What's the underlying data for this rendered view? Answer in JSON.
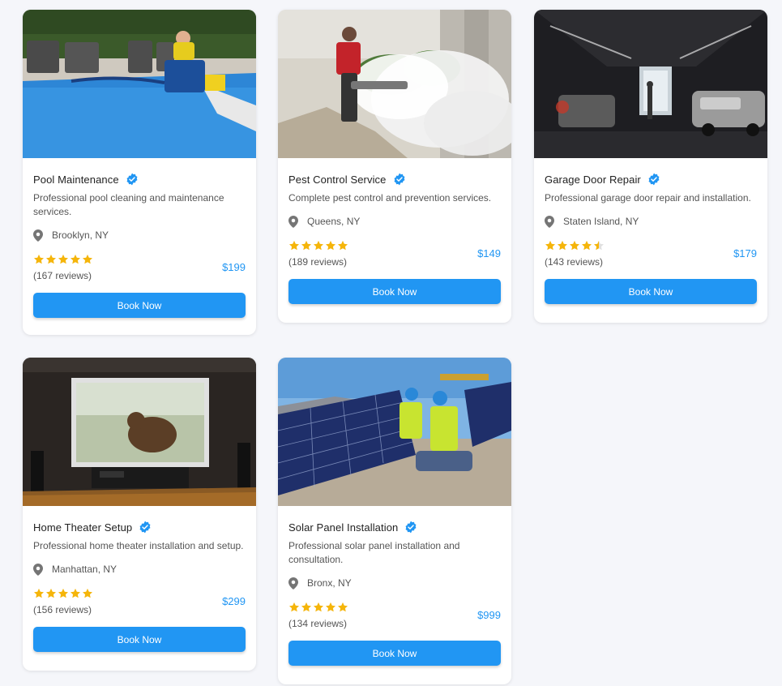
{
  "colors": {
    "accent": "#2196f3",
    "star": "#f5b50a",
    "verified": "#2196f3",
    "background": "#f5f6fa"
  },
  "icons": {
    "verified": "verified-badge-icon",
    "location": "map-pin-icon",
    "star": "star-icon"
  },
  "button_label": "Book Now",
  "services": [
    {
      "title": "Pool Maintenance",
      "description": "Professional pool cleaning and maintenance services.",
      "location": "Brooklyn, NY",
      "rating": 5,
      "reviews": "(167 reviews)",
      "price": "$199",
      "image": "pool-cleaning-photo"
    },
    {
      "title": "Pest Control Service",
      "description": "Complete pest control and prevention services.",
      "location": "Queens, NY",
      "rating": 5,
      "reviews": "(189 reviews)",
      "price": "$149",
      "image": "pest-fogging-photo"
    },
    {
      "title": "Garage Door Repair",
      "description": "Professional garage door repair and installation.",
      "location": "Staten Island, NY",
      "rating": 4.5,
      "reviews": "(143 reviews)",
      "price": "$179",
      "image": "garage-workshop-photo"
    },
    {
      "title": "Home Theater Setup",
      "description": "Professional home theater installation and setup.",
      "location": "Manhattan, NY",
      "rating": 5,
      "reviews": "(156 reviews)",
      "price": "$299",
      "image": "home-theater-photo"
    },
    {
      "title": "Solar Panel Installation",
      "description": "Professional solar panel installation and consultation.",
      "location": "Bronx, NY",
      "rating": 5,
      "reviews": "(134 reviews)",
      "price": "$999",
      "image": "solar-panels-photo"
    }
  ]
}
